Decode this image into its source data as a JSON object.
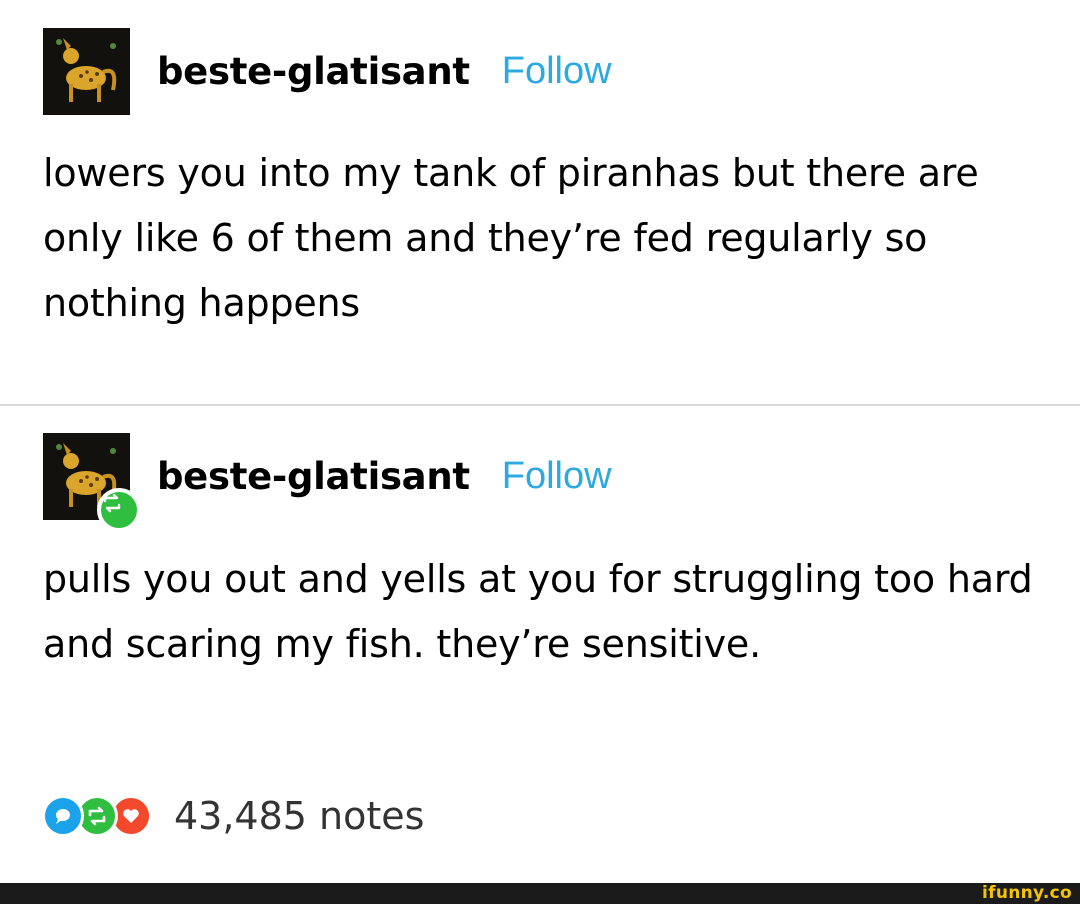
{
  "posts": [
    {
      "username": "beste-glatisant",
      "follow_label": "Follow",
      "text": "lowers you into my tank of piranhas but there are only like 6 of them and they’re fed regularly so nothing happens",
      "reblog_badge": false
    },
    {
      "username": "beste-glatisant",
      "follow_label": "Follow",
      "text": "pulls you out and yells at you for struggling too hard and scaring my fish. they’re sensitive.",
      "reblog_badge": true
    }
  ],
  "notes": {
    "count_label": "43,485 notes",
    "icons": [
      "reply-icon",
      "reblog-icon",
      "heart-icon"
    ]
  },
  "watermark": "ifunny.co",
  "colors": {
    "follow": "#2ca9e1",
    "reblog_green": "#2fbe3f",
    "reply_blue": "#1aa3ea",
    "like_red": "#f2492c",
    "watermark_yellow": "#f4c400"
  }
}
